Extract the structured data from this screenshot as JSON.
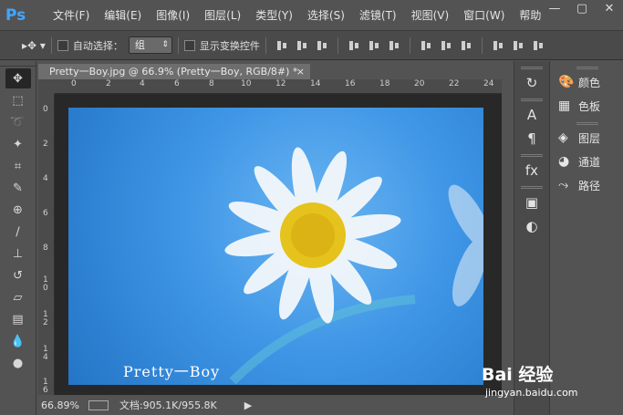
{
  "app": {
    "logo": "Ps"
  },
  "menu": [
    "文件(F)",
    "编辑(E)",
    "图像(I)",
    "图层(L)",
    "类型(Y)",
    "选择(S)",
    "滤镜(T)",
    "视图(V)",
    "窗口(W)",
    "帮助"
  ],
  "window_controls": {
    "minimize": "—",
    "restore": "▢",
    "close": "✕"
  },
  "options": {
    "auto_select_label": "自动选择：",
    "auto_select_value": "组",
    "show_transform_label": "显示变换控件"
  },
  "document": {
    "tab_title": "Pretty一Boy.jpg @ 66.9% (Pretty一Boy, RGB/8#) *",
    "tab_close": "×",
    "watermark_text": "Pretty一Boy"
  },
  "ruler": {
    "horizontal": [
      "0",
      "2",
      "4",
      "6",
      "8",
      "10",
      "12",
      "14",
      "16",
      "18",
      "20",
      "22",
      "24"
    ],
    "vertical": [
      "0",
      "2",
      "4",
      "6",
      "8",
      "1\n0",
      "1\n2",
      "1\n4",
      "1\n6"
    ]
  },
  "status": {
    "zoom": "66.89%",
    "doc_info": "文档:905.1K/955.8K",
    "arrow": "▶"
  },
  "panels": [
    {
      "icon": "palette-icon",
      "glyph": "🎨",
      "label": "颜色"
    },
    {
      "icon": "grid-icon",
      "glyph": "▦",
      "label": "色板"
    },
    {
      "icon": "layers-icon",
      "glyph": "◈",
      "label": "图层"
    },
    {
      "icon": "channels-icon",
      "glyph": "◕",
      "label": "通道"
    },
    {
      "icon": "paths-icon",
      "glyph": "⤳",
      "label": "路径"
    }
  ],
  "baidu": {
    "brand": "Bai 经验",
    "url": "jingyan.baidu.com"
  },
  "colors": {
    "ps_blue": "#3fa6ff",
    "image_sky": "#3f96e6"
  }
}
